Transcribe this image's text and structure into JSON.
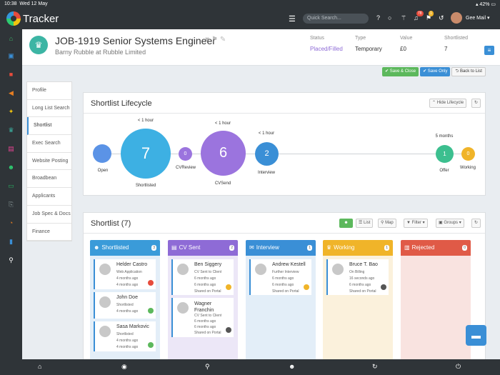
{
  "statusbar": {
    "time": "10:38",
    "date": "Wed 12 May",
    "battery": "42%"
  },
  "topbar": {
    "app_name": "Tracker",
    "search_placeholder": "Quick Search...",
    "badge_notifications": "78",
    "badge_tasks": "1",
    "user_name": "Gee Mail"
  },
  "job": {
    "title": "JOB-1919 Senior Systems Engineer",
    "company": "Barny Rubble at Rubble Limited",
    "status_label": "Status",
    "status_value": "Placed/Filled",
    "type_label": "Type",
    "type_value": "Temporary",
    "value_label": "Value",
    "value_value": "£0",
    "shortlisted_label": "Shortlisted",
    "shortlisted_value": "7"
  },
  "actions": {
    "save_close": "Save & Close",
    "save_only": "Save Only",
    "back": "Back to List"
  },
  "tabs": [
    "Profile",
    "Long List Search",
    "Shortlist",
    "Exec Search",
    "Website Posting",
    "Broadbean",
    "Applicants",
    "Job Spec & Docs",
    "Finance"
  ],
  "lifecycle": {
    "title": "Shortlist Lifecycle",
    "hide_btn": "Hide Lifecycle",
    "stages": [
      {
        "name": "Open",
        "count": "",
        "time": ""
      },
      {
        "name": "Shortlisted",
        "count": "7",
        "time": "< 1 hour"
      },
      {
        "name": "CVReview",
        "count": "0",
        "time": ""
      },
      {
        "name": "CVSend",
        "count": "6",
        "time": "< 1 hour"
      },
      {
        "name": "Interview",
        "count": "2",
        "time": "< 1 hour"
      },
      {
        "name": "Offer",
        "count": "1",
        "time": "5 months"
      },
      {
        "name": "Working",
        "count": "0",
        "time": ""
      }
    ]
  },
  "shortlist": {
    "title": "Shortlist (7)",
    "list_btn": "List",
    "map_btn": "Map",
    "filter_btn": "Filter",
    "groups_btn": "Groups",
    "columns": [
      {
        "name": "Shortlisted",
        "count": "3",
        "color": "#3a9bd9",
        "cards": [
          {
            "name": "Helder Castro",
            "line1": "Web Application",
            "line2": "4 months ago",
            "line3": "4 months ago",
            "dot": "#e74c3c"
          },
          {
            "name": "John Doe",
            "line1": "Shortlisted",
            "line2": "4 months ago",
            "dot": "#5cb85c"
          },
          {
            "name": "Sasa Markovic",
            "line1": "Shortlisted",
            "line2": "4 months ago",
            "line3": "4 months ago",
            "dot": "#5cb85c"
          }
        ]
      },
      {
        "name": "CV Sent",
        "count": "2",
        "color": "#8e6bd6",
        "cards": [
          {
            "name": "Ben Siggery",
            "line1": "CV Sent to Client",
            "line2": "6 months ago",
            "line3": "6 months ago",
            "line4": "Shared on Portal",
            "dot": "#f0b429"
          },
          {
            "name": "Wagner Franchin",
            "line1": "CV Sent to Client",
            "line2": "6 months ago",
            "line3": "6 months ago",
            "line4": "Shared on Portal",
            "dot": "#555555"
          }
        ]
      },
      {
        "name": "Interview",
        "count": "1",
        "color": "#3a8fd6",
        "cards": [
          {
            "name": "Andrew Kestell",
            "line1": "Further Interview",
            "line2": "6 months ago",
            "line3": "6 months ago",
            "line4": "Shared on Portal",
            "dot": "#f0b429"
          }
        ]
      },
      {
        "name": "Working",
        "count": "1",
        "color": "#f0b429",
        "cards": [
          {
            "name": "Bruce T. Bao",
            "line1": "On Billing",
            "line2": "16 seconds ago",
            "line3": "6 months ago",
            "line4": "Shared on Portal",
            "dot": "#555555"
          }
        ]
      },
      {
        "name": "Rejected",
        "count": "0",
        "color": "#e05a47",
        "cards": []
      }
    ]
  },
  "colors": {
    "topbar": "#2f3438",
    "accent": "#3a8fd6",
    "placed": "#8e6bd6"
  }
}
